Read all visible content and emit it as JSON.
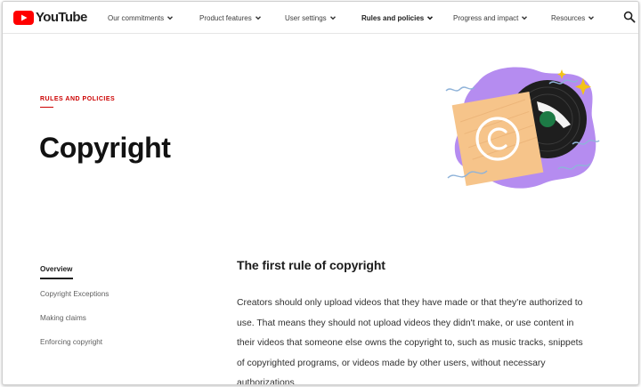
{
  "brand": {
    "name": "YouTube",
    "red": "#ff0000"
  },
  "nav": {
    "items": [
      {
        "label": "Our commitments"
      },
      {
        "label": "Product features"
      },
      {
        "label": "User settings"
      },
      {
        "label": "Rules and policies",
        "active": true
      },
      {
        "label": "Progress and impact"
      },
      {
        "label": "Resources"
      }
    ],
    "search_icon": "search-icon",
    "chevron_icon": "chevron-down-icon"
  },
  "hero": {
    "eyebrow": "RULES AND POLICIES",
    "title": "Copyright",
    "accent": "#cc0000"
  },
  "illustration": {
    "blob": "#b58cf0",
    "sleeve": "#f6c48a",
    "record": "#1e1e1e",
    "label_green": "#1d7a45",
    "squiggle": "#8fb3d9",
    "sparkle": "#f3c316",
    "icon": "copyright-icon"
  },
  "subnav": {
    "items": [
      {
        "label": "Overview",
        "active": true
      },
      {
        "label": "Copyright Exceptions"
      },
      {
        "label": "Making claims"
      },
      {
        "label": "Enforcing copyright"
      }
    ]
  },
  "main": {
    "heading": "The first rule of copyright",
    "lines": [
      "Creators should only upload videos that they have made or that they're authorized to",
      "use. That means they should not upload videos they didn't make, or use content in",
      "their videos that someone else owns the copyright to, such as music tracks, snippets",
      "of copyrighted programs, or videos made by other users, without necessary",
      "authorizations."
    ]
  }
}
